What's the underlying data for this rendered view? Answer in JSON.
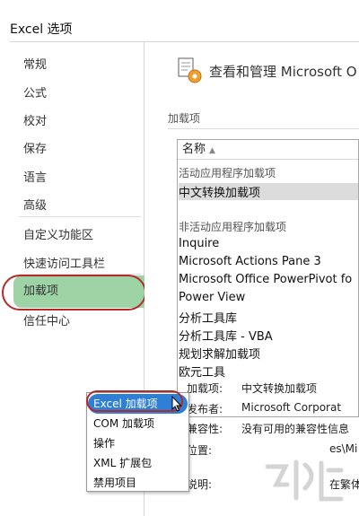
{
  "window": {
    "title": "Excel 选项"
  },
  "sidebar": {
    "items": [
      {
        "label": "常规"
      },
      {
        "label": "公式"
      },
      {
        "label": "校对"
      },
      {
        "label": "保存"
      },
      {
        "label": "语言"
      },
      {
        "label": "高级"
      },
      {
        "label": "自定义功能区"
      },
      {
        "label": "快速访问工具栏"
      },
      {
        "label": "加载项",
        "selected": true
      },
      {
        "label": "信任中心"
      }
    ]
  },
  "main": {
    "header": "查看和管理 Microsoft O",
    "section_label": "加载项",
    "list": {
      "column_header": "名称",
      "sort_indicator": "▲",
      "active_group": "活动应用程序加载项",
      "active_items": [
        "中文转换加载项"
      ],
      "inactive_group": "非活动应用程序加载项",
      "inactive_items": [
        "Inquire",
        "Microsoft Actions Pane 3",
        "Microsoft Office PowerPivot fo",
        "Power View",
        "分析工具库",
        "分析工具库 - VBA",
        "规划求解加载项",
        "欧元工具"
      ]
    },
    "details": {
      "addin_label": "加载项:",
      "addin_value": "中文转换加载项",
      "publisher_label": "发布者:",
      "publisher_value": "Microsoft Corporat",
      "compat_label": "兼容性:",
      "compat_value": "没有可用的兼容性信息",
      "location_label": "位置:",
      "location_value_partial": "es\\Mi",
      "description_label": "说明:",
      "description_value_partial": "在繁体"
    },
    "manage_dropdown": {
      "options": [
        {
          "label": "Excel 加载项",
          "selected": true
        },
        {
          "label": "COM 加载项"
        },
        {
          "label": "操作"
        },
        {
          "label": "XML 扩展包"
        },
        {
          "label": "禁用项目"
        }
      ]
    }
  },
  "colors": {
    "selected_nav_bg": "#9ed3a6",
    "highlight_ring": "#b42a2a",
    "dropdown_selected": "#2e7fd6"
  },
  "icons": [
    "addins-manage-icon",
    "mouse-cursor-icon"
  ]
}
